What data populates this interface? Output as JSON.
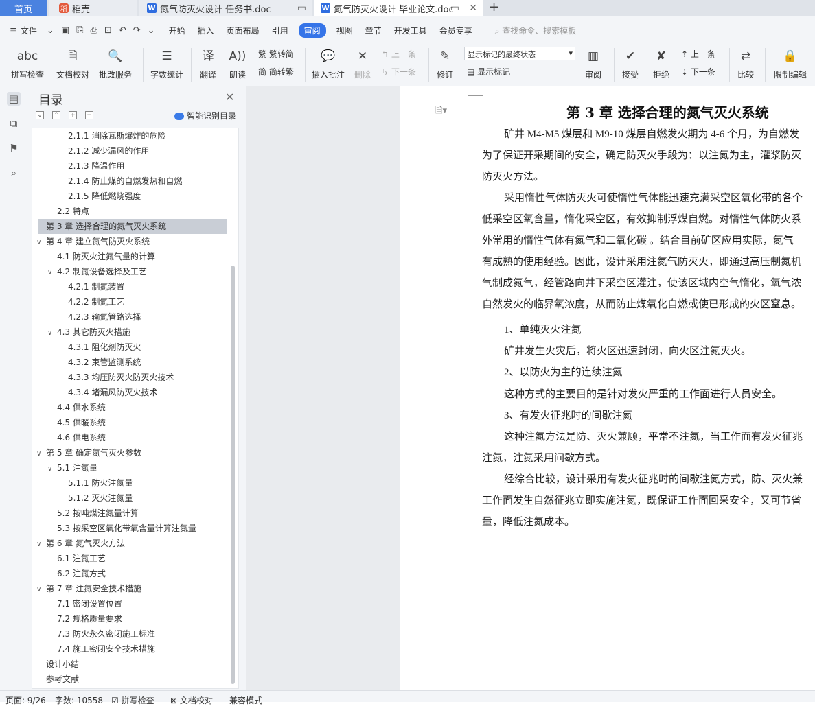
{
  "tabs": [
    {
      "label": "首页"
    },
    {
      "label": "稻壳",
      "icon": "daoke-icon"
    },
    {
      "label": "氮气防灭火设计 任务书.doc",
      "icon": "wps-writer-icon"
    },
    {
      "label": "氮气防灭火设计 毕业论文.doc",
      "icon": "wps-writer-icon"
    }
  ],
  "menu": {
    "file": "文件",
    "items": [
      "开始",
      "插入",
      "页面布局",
      "引用",
      "审阅",
      "视图",
      "章节",
      "开发工具",
      "会员专享"
    ],
    "active": "审阅",
    "search": "查找命令、搜索模板"
  },
  "ribbon": {
    "spell": "拼写检查",
    "proof": "文档校对",
    "annotate": "批改服务",
    "wordcount": "字数统计",
    "translate": "翻译",
    "read": "朗读",
    "trad": "繁转简",
    "simp": "简转繁",
    "insert_comment": "插入批注",
    "delete": "删除",
    "prev": "上一条",
    "next": "下一条",
    "track": "修订",
    "markup_state": "显示标记的最终状态",
    "show_markup": "显示标记",
    "review_pane": "审阅",
    "accept": "接受",
    "reject": "拒绝",
    "prev2": "上一条",
    "next2": "下一条",
    "compare": "比较",
    "restrict": "限制编辑"
  },
  "toc": {
    "title": "目录",
    "smart": "智能识别目录",
    "items": [
      {
        "text": "2.1.1 消除瓦斯爆炸的危险"
      },
      {
        "text": "2.1.2 减少漏风的作用"
      },
      {
        "text": "2.1.3 降温作用"
      },
      {
        "text": "2.1.4 防止煤的自燃发热和自燃"
      },
      {
        "text": "2.1.5 降低燃烧强度"
      },
      {
        "text": "2.2 特点"
      },
      {
        "text": "第 3 章 选择合理的氮气灭火系统"
      },
      {
        "text": "第 4 章 建立氮气防灭火系统"
      },
      {
        "text": "4.1 防灭火注氮气量的计算"
      },
      {
        "text": "4.2 制氮设备选择及工艺"
      },
      {
        "text": "4.2.1 制氮装置"
      },
      {
        "text": "4.2.2 制氮工艺"
      },
      {
        "text": "4.2.3 输氮管路选择"
      },
      {
        "text": "4.3 其它防灭火措施"
      },
      {
        "text": "4.3.1 阻化剂防灭火"
      },
      {
        "text": "4.3.2 束管监测系统"
      },
      {
        "text": "4.3.3 均压防灭火防灭火技术"
      },
      {
        "text": "4.3.4 堵漏风防灭火技术"
      },
      {
        "text": "4.4 供水系统"
      },
      {
        "text": "4.5 供暖系统"
      },
      {
        "text": "4.6 供电系统"
      },
      {
        "text": "第 5 章 确定氮气灭火参数"
      },
      {
        "text": "5.1 注氮量"
      },
      {
        "text": "5.1.1 防火注氮量"
      },
      {
        "text": "5.1.2 灭火注氮量"
      },
      {
        "text": "5.2 按吨煤注氮量计算"
      },
      {
        "text": "5.3 按采空区氧化带氧含量计算注氮量"
      },
      {
        "text": "第 6 章 氮气灭火方法"
      },
      {
        "text": "6.1 注氮工艺"
      },
      {
        "text": "6.2 注氮方式"
      },
      {
        "text": "第 7 章 注氮安全技术措施"
      },
      {
        "text": "7.1 密闭设置位置"
      },
      {
        "text": "7.2 规格质量要求"
      },
      {
        "text": "7.3 防火永久密闭施工标准"
      },
      {
        "text": "7.4 施工密闭安全技术措施"
      },
      {
        "text": "设计小结"
      },
      {
        "text": "参考文献"
      }
    ]
  },
  "doc": {
    "title": "第 3 章  选择合理的氮气灭火系统",
    "lines": [
      "矿井 M4-M5 煤层和 M9-10 煤层自燃发火期为 4-6 个月，为自燃发",
      "为了保证开采期间的安全，确定防灭火手段为：以注氮为主，灌浆防灭",
      "防灭火方法。",
      "采用惰性气体防灭火可使惰性气体能迅速充满采空区氧化带的各个",
      "低采空区氧含量，惰化采空区，有效抑制浮煤自燃。对惰性气体防火系",
      "外常用的惰性气体有氮气和二氧化碳 。结合目前矿区应用实际，氮气",
      "有成熟的使用经验。因此，设计采用注氮气防灭火，即通过高压制氮机",
      "气制成氮气，经管路向井下采空区灌注，使该区域内空气惰化，氧气浓",
      "自然发火的临界氧浓度，从而防止煤氧化自燃或使已形成的火区窒息。",
      "1、单纯灭火注氮",
      "矿井发生火灾后，将火区迅速封闭，向火区注氮灭火。",
      "2、以防火为主的连续注氮",
      "这种方式的主要目的是针对发火严重的工作面进行人员安全。",
      "3、有发火征兆时的间歇注氮",
      "这种注氮方法是防、灭火兼顾，平常不注氮，当工作面有发火征兆",
      "注氮，注氮采用间歇方式。",
      "经综合比较，设计采用有发火征兆时的间歇注氮方式，防、灭火兼",
      "工作面发生自然征兆立即实施注氮，既保证工作面回采安全，又可节省",
      "量，降低注氮成本。"
    ]
  },
  "status": {
    "page": "页面: 9/26",
    "words": "字数: 10558",
    "spell": "拼写检查",
    "proof": "文档校对",
    "compat": "兼容模式"
  },
  "colors": {
    "accent": "#3574e8",
    "home_tab": "#4a82e0",
    "toc_selected": "#c9ced6"
  }
}
